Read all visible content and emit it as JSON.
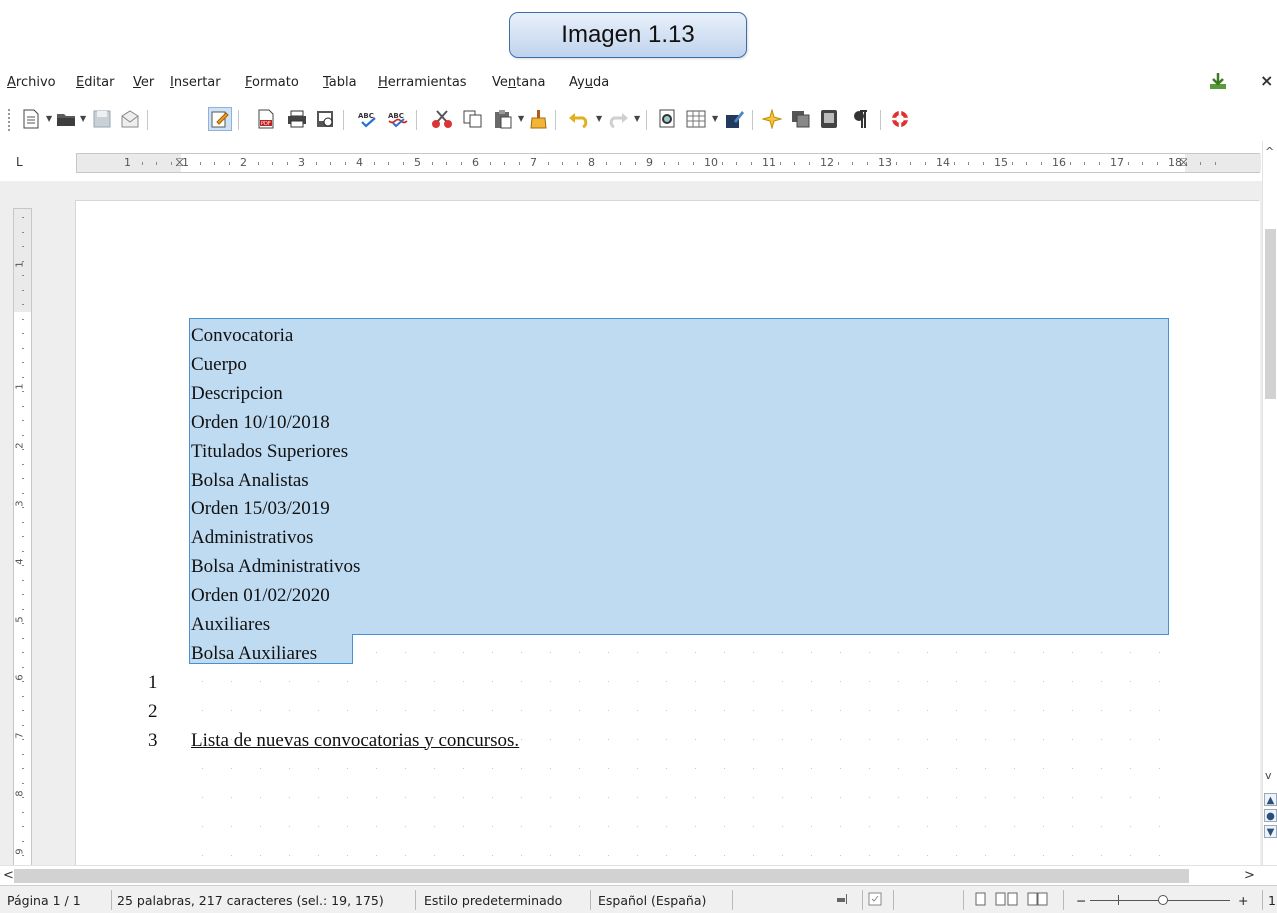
{
  "caption": {
    "text": "Imagen 1.13"
  },
  "menu": {
    "items": [
      {
        "pre": "",
        "ul": "A",
        "post": "rchivo"
      },
      {
        "pre": "",
        "ul": "E",
        "post": "ditar"
      },
      {
        "pre": "",
        "ul": "V",
        "post": "er"
      },
      {
        "pre": "",
        "ul": "I",
        "post": "nsertar"
      },
      {
        "pre": "",
        "ul": "F",
        "post": "ormato"
      },
      {
        "pre": "",
        "ul": "T",
        "post": "abla"
      },
      {
        "pre": "",
        "ul": "H",
        "post": "erramientas"
      },
      {
        "pre": "Ve",
        "ul": "n",
        "post": "tana"
      },
      {
        "pre": "Ay",
        "ul": "u",
        "post": "da"
      }
    ],
    "close_glyph": "×"
  },
  "ruler": {
    "corner_glyph": "L",
    "h_numbers": [
      "1",
      "1",
      "2",
      "3",
      "4",
      "5",
      "6",
      "7",
      "8",
      "9",
      "10",
      "11",
      "12",
      "13",
      "14",
      "15",
      "16",
      "17",
      "18"
    ],
    "v_numbers": [
      "1",
      "1",
      "2",
      "3",
      "4",
      "5",
      "6",
      "7",
      "8",
      "9"
    ]
  },
  "document": {
    "selected_lines": [
      "Convocatoria",
      "Cuerpo",
      "Descripcion",
      "Orden 10/10/2018",
      "Titulados Superiores",
      "Bolsa Analistas",
      "Orden 15/03/2019",
      "Administrativos",
      "Bolsa Administrativos",
      "Orden 01/02/2020",
      "Auxiliares",
      "Bolsa Auxiliares"
    ],
    "line_numbers": [
      "1",
      "2",
      "3"
    ],
    "heading": "Lista de nuevas convocatorias y concursos."
  },
  "status": {
    "page": "Página 1 / 1",
    "words": "25 palabras, 217 caracteres (sel.: 19, 175)",
    "style": "Estilo predeterminado",
    "language": "Español (España)",
    "zoom_minus": "−",
    "zoom_plus": "+",
    "zoom_trailing": "1"
  },
  "colors": {
    "selection": "#bfdbf2",
    "selection_border": "#4a8fd1",
    "caption_border": "#3e6ea8"
  }
}
